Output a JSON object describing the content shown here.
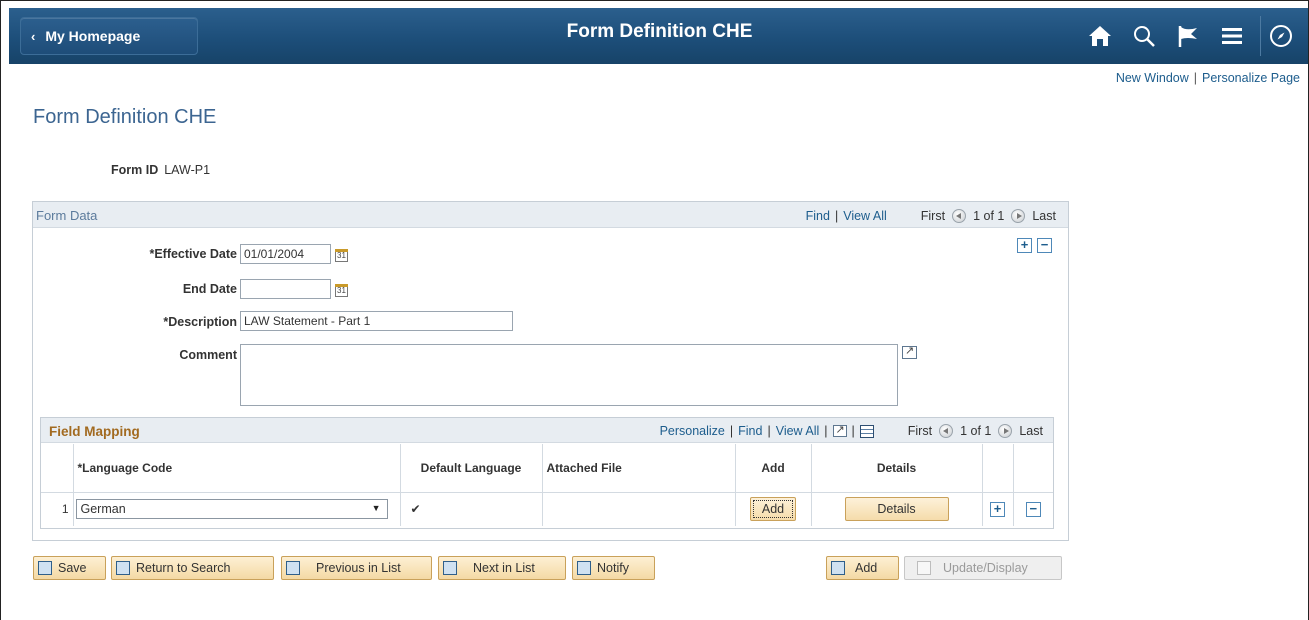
{
  "header": {
    "back_label": "My Homepage",
    "title": "Form Definition CHE",
    "icons": [
      "home-icon",
      "search-icon",
      "flag-icon",
      "menu-icon",
      "navbar-compass-icon"
    ]
  },
  "links": {
    "new_window": "New Window",
    "personalize_page": "Personalize Page",
    "separator": "|"
  },
  "page": {
    "title": "Form Definition CHE",
    "form_id_label": "Form ID",
    "form_id_value": "LAW-P1"
  },
  "form_data": {
    "title": "Form Data",
    "find": "Find",
    "view_all": "View All",
    "first": "First",
    "count": "1 of 1",
    "last": "Last",
    "fields": {
      "effective_date_label": "*Effective Date",
      "effective_date_value": "01/01/2004",
      "end_date_label": "End Date",
      "end_date_value": "",
      "description_label": "*Description",
      "description_value": "LAW Statement - Part 1",
      "comment_label": "Comment",
      "comment_value": ""
    }
  },
  "field_mapping": {
    "title": "Field Mapping",
    "personalize": "Personalize",
    "find": "Find",
    "view_all": "View All",
    "first": "First",
    "count": "1 of 1",
    "last": "Last",
    "columns": [
      "*Language Code",
      "Default Language",
      "Attached File",
      "Add",
      "Details"
    ],
    "rows": [
      {
        "num": "1",
        "language": "German",
        "default": true,
        "file": "",
        "add_label": "Add",
        "details_label": "Details"
      }
    ]
  },
  "toolbar": {
    "save": "Save",
    "return_to_search": "Return to Search",
    "previous_in_list": "Previous in List",
    "next_in_list": "Next in List",
    "notify": "Notify",
    "add": "Add",
    "update_display": "Update/Display"
  },
  "colors": {
    "header_blue": "#1c4d78",
    "link_blue": "#1d5d8d",
    "grid_title": "#a26a20",
    "button_fill": "#f5dcab"
  }
}
